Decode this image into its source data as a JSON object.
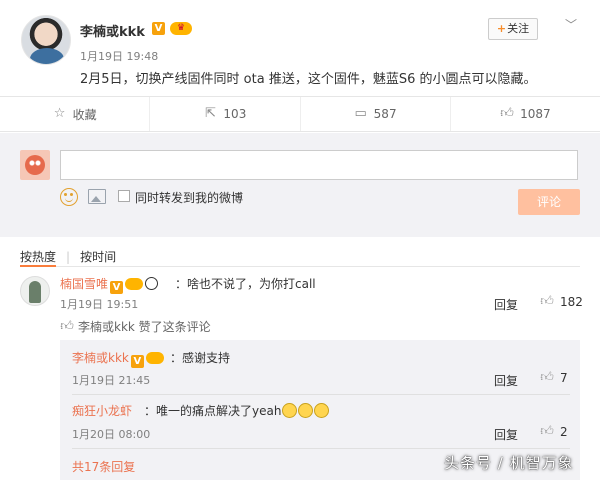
{
  "post": {
    "username": "李楠或kkk",
    "time": "1月19日 19:48",
    "text": "2月5日，切换产线固件同时 ota 推送，这个固件，魅蓝S6 的小圆点可以隐藏。",
    "follow_label": "关注",
    "follow_plus": "+",
    "more_icon": "﹀"
  },
  "actions": [
    {
      "label": "收藏",
      "icon": "star-icon"
    },
    {
      "label": "103",
      "icon": "repost-icon"
    },
    {
      "label": "587",
      "icon": "comment-icon"
    },
    {
      "label": "1087",
      "icon": "like-icon"
    }
  ],
  "compose": {
    "placeholder": "",
    "repost_label": "同时转发到我的微博",
    "submit_label": "评论"
  },
  "sort": {
    "by_hot": "按热度",
    "separator": "|",
    "by_time": "按时间"
  },
  "comments": [
    {
      "name": "楠国雪唯",
      "text": "：啥也不说了，为你打call",
      "time": "1月19日 19:51",
      "reply": "回复",
      "likes": "182",
      "liked_by": "李楠或kkk 赞了这条评论"
    }
  ],
  "replies": [
    {
      "name": "李楠或kkk",
      "text": "：感谢支持",
      "time": "1月19日 21:45",
      "reply": "回复",
      "likes": "7"
    },
    {
      "name": "痴狂小龙虾",
      "text": "：唯一的痛点解决了yeah",
      "time": "1月20日 08:00",
      "reply": "回复",
      "likes": "2"
    }
  ],
  "more_replies": "共17条回复",
  "watermark": "头条号 / 机智万象",
  "colors": {
    "accent": "#eb7350",
    "submit": "#ffc09f",
    "badge": "#f7a20c"
  }
}
